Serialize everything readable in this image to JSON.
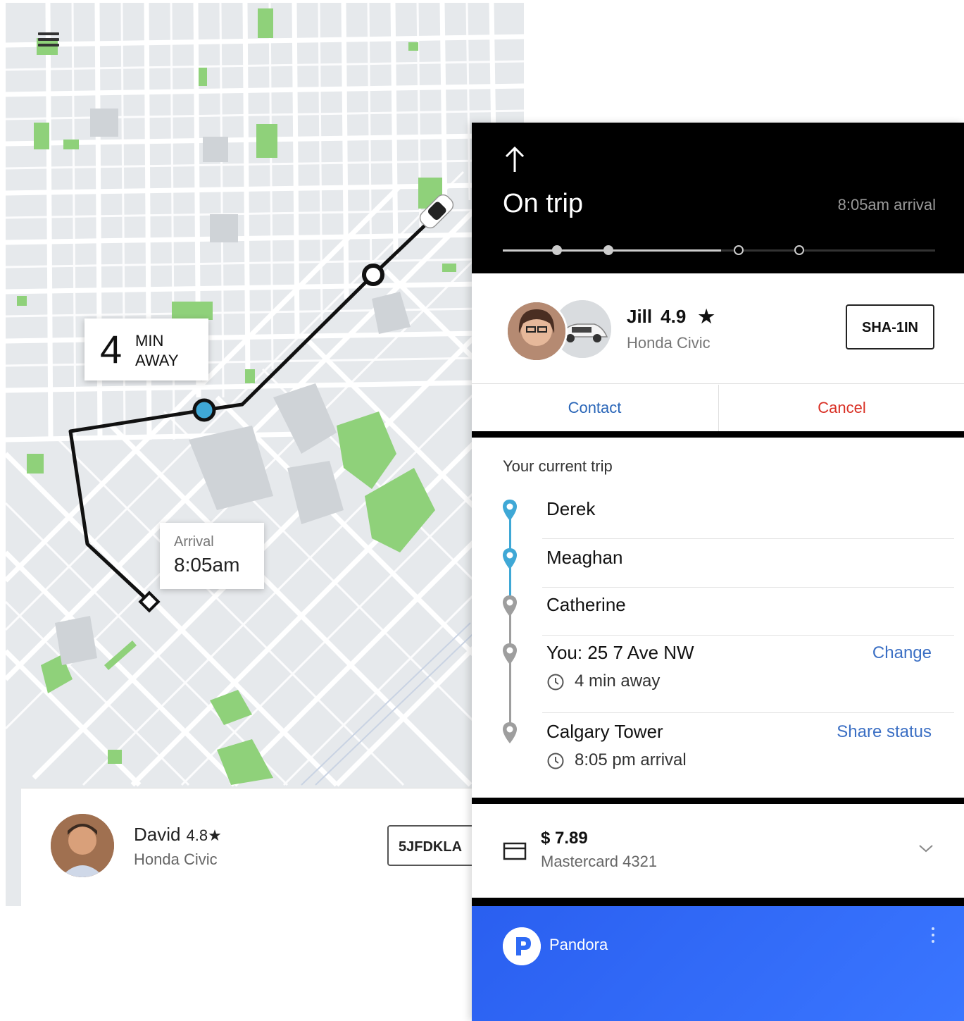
{
  "map_screen": {
    "eta": {
      "number": "4",
      "unit_line1": "MIN",
      "unit_line2": "AWAY"
    },
    "arrival": {
      "label": "Arrival",
      "time": "8:05am"
    },
    "driver": {
      "name": "David",
      "rating": "4.8★",
      "car": "Honda Civic",
      "plate": "5JFDKLA"
    },
    "icons": [
      "menu-icon",
      "car-icon",
      "pickup-marker-icon",
      "destination-marker-icon"
    ]
  },
  "trip_screen": {
    "header": {
      "title": "On trip",
      "arrival": "8:05am arrival"
    },
    "progress": {
      "completed_stops": 2,
      "total_stops": 4
    },
    "driver": {
      "name": "Jill",
      "rating": "4.9",
      "star": "★",
      "car": "Honda Civic",
      "plate": "SHA-1IN"
    },
    "actions": {
      "contact": "Contact",
      "cancel": "Cancel"
    },
    "section_title": "Your current trip",
    "stops": [
      {
        "name": "Derek",
        "status": "completed"
      },
      {
        "name": "Meaghan",
        "status": "completed"
      },
      {
        "name": "Catherine",
        "status": "upcoming"
      },
      {
        "name": "You: 25 7 Ave NW",
        "sub": "4 min away",
        "action": "Change",
        "status": "upcoming"
      },
      {
        "name": "Calgary Tower",
        "sub": "8:05 pm arrival",
        "action": "Share status",
        "status": "upcoming"
      }
    ],
    "payment": {
      "amount": "$ 7.89",
      "card": "Mastercard 4321"
    },
    "media": {
      "app": "Pandora"
    }
  },
  "colors": {
    "accent_blue": "#2a66b8",
    "cancel_red": "#d93025",
    "route_blue": "#3fa8d6",
    "park_green": "#8fd17a",
    "pandora_blue": "#3366ff"
  }
}
